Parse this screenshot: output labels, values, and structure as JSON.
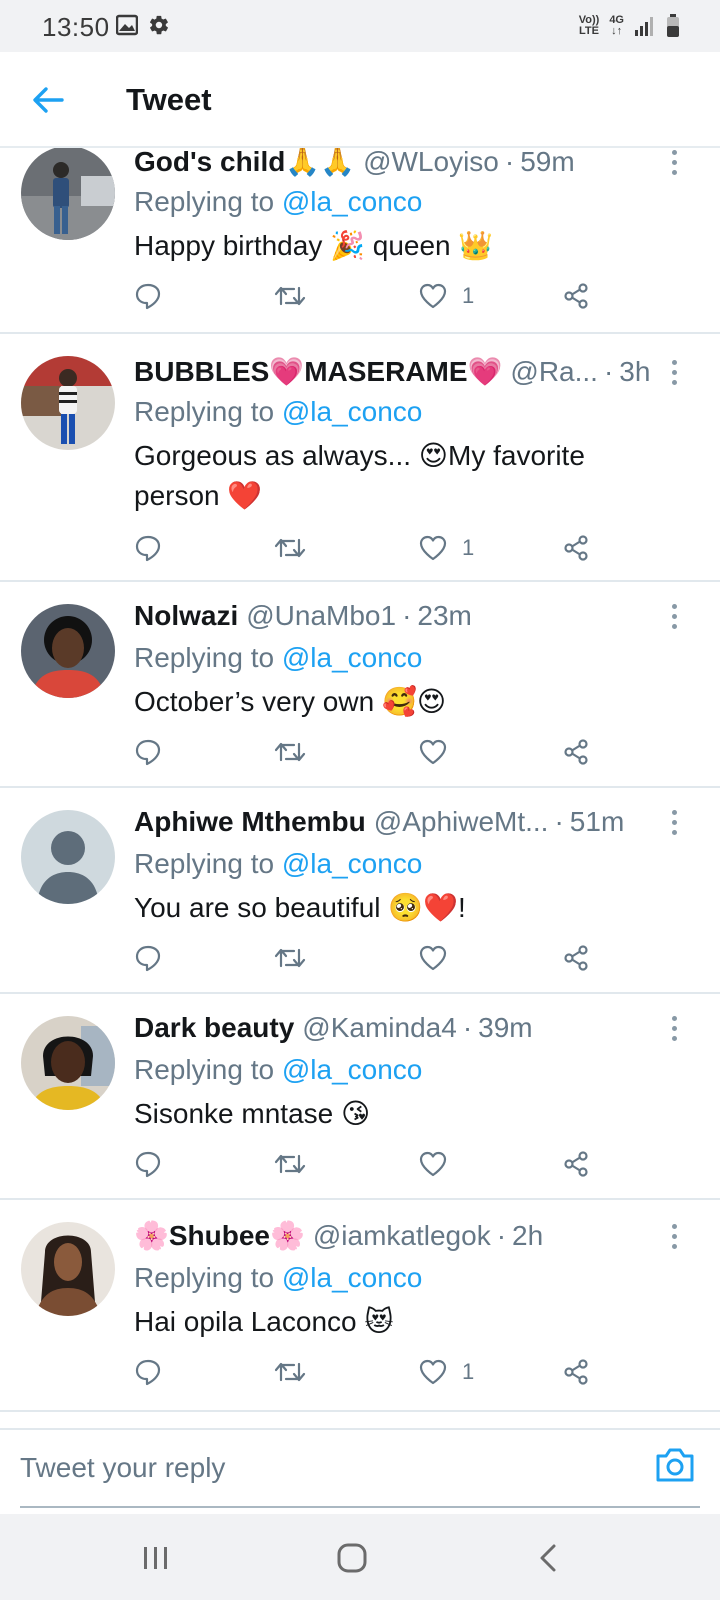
{
  "status_bar": {
    "time": "13:50",
    "volte_top": "Vo))",
    "volte_bottom": "LTE",
    "network": "4G",
    "icons": [
      "gallery-icon",
      "gear-icon",
      "signal-icon",
      "battery-icon"
    ]
  },
  "header": {
    "title": "Tweet",
    "back_icon": "arrow-left-icon"
  },
  "accent_color": "#1da1f2",
  "replying_label": "Replying to",
  "tweets": [
    {
      "name": "God's child",
      "name_suffix": "🙏🙏",
      "handle": "@WLoyiso",
      "time": "59m",
      "reply_to": "@la_conco",
      "text": "Happy birthday 🎉 queen 👑",
      "likes": "1"
    },
    {
      "name": "BUBBLES💗MASERAME💗",
      "name_suffix": "",
      "handle": "@Ra...",
      "time": "3h",
      "reply_to": "@la_conco",
      "text": "Gorgeous as always... 😍My favorite person ❤️",
      "likes": "1"
    },
    {
      "name": "Nolwazi",
      "name_suffix": "",
      "handle": "@UnaMbo1",
      "time": "23m",
      "reply_to": "@la_conco",
      "text": "October’s very own 🥰😍",
      "likes": ""
    },
    {
      "name": "Aphiwe Mthembu",
      "name_suffix": "",
      "handle": "@AphiweMt...",
      "time": "51m",
      "reply_to": "@la_conco",
      "text": "You are so beautiful 🥺❤️!",
      "likes": ""
    },
    {
      "name": "Dark beauty",
      "name_suffix": "",
      "handle": "@Kaminda4",
      "time": "39m",
      "reply_to": "@la_conco",
      "text": "Sisonke mntase 😘",
      "likes": ""
    },
    {
      "name": "🌸Shubee🌸",
      "name_suffix": "",
      "handle": "@iamkatlegok",
      "time": "2h",
      "reply_to": "@la_conco",
      "text": "Hai opila Laconco 😻",
      "likes": "1"
    }
  ],
  "composer": {
    "placeholder": "Tweet your reply",
    "camera_icon": "camera-icon"
  },
  "nav_bar": {
    "buttons": [
      "recent-apps-icon",
      "home-icon",
      "back-icon"
    ]
  }
}
